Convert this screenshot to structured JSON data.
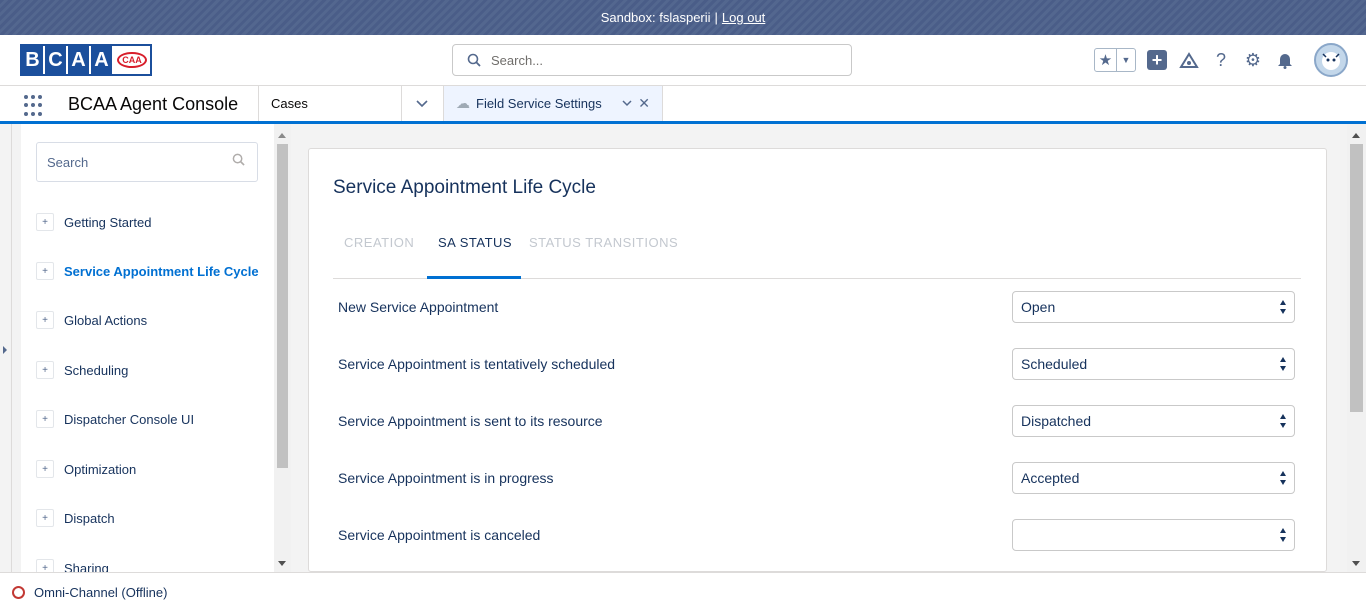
{
  "sandbox": {
    "text": "Sandbox: fslasperii",
    "separator": "|",
    "logout": "Log out"
  },
  "logo": {
    "letters": [
      "B",
      "C",
      "A",
      "A"
    ],
    "badge": "CAA"
  },
  "global_search": {
    "placeholder": "Search..."
  },
  "header_icons": [
    "star-icon",
    "chevron-down-icon",
    "plus-icon",
    "trailhead-icon",
    "help-icon",
    "gear-icon",
    "bell-icon",
    "avatar"
  ],
  "nav": {
    "app_name": "BCAA Agent Console",
    "item": "Cases",
    "tab": {
      "label": "Field Service Settings"
    }
  },
  "sidebar": {
    "search_placeholder": "Search",
    "items": [
      {
        "label": "Getting Started",
        "active": false
      },
      {
        "label": "Service Appointment Life Cycle",
        "active": true
      },
      {
        "label": "Global Actions",
        "active": false
      },
      {
        "label": "Scheduling",
        "active": false
      },
      {
        "label": "Dispatcher Console UI",
        "active": false
      },
      {
        "label": "Optimization",
        "active": false
      },
      {
        "label": "Dispatch",
        "active": false
      },
      {
        "label": "Sharing",
        "active": false
      }
    ]
  },
  "main": {
    "title": "Service Appointment Life Cycle",
    "tabs": [
      {
        "label": "CREATION",
        "active": false
      },
      {
        "label": "SA STATUS",
        "active": true
      },
      {
        "label": "STATUS TRANSITIONS",
        "active": false
      }
    ],
    "rows": [
      {
        "label": "New Service Appointment",
        "value": "Open"
      },
      {
        "label": "Service Appointment is tentatively scheduled",
        "value": "Scheduled"
      },
      {
        "label": "Service Appointment is sent to its resource",
        "value": "Dispatched"
      },
      {
        "label": "Service Appointment is in progress",
        "value": "Accepted"
      },
      {
        "label": "Service Appointment is canceled",
        "value": ""
      }
    ]
  },
  "utility_bar": {
    "label": "Omni-Channel (Offline)"
  },
  "colors": {
    "brand": "#0070d2",
    "sandbox_bar": "#4a5d88",
    "logo_blue": "#1b4f9c",
    "offline_red": "#c23934"
  }
}
